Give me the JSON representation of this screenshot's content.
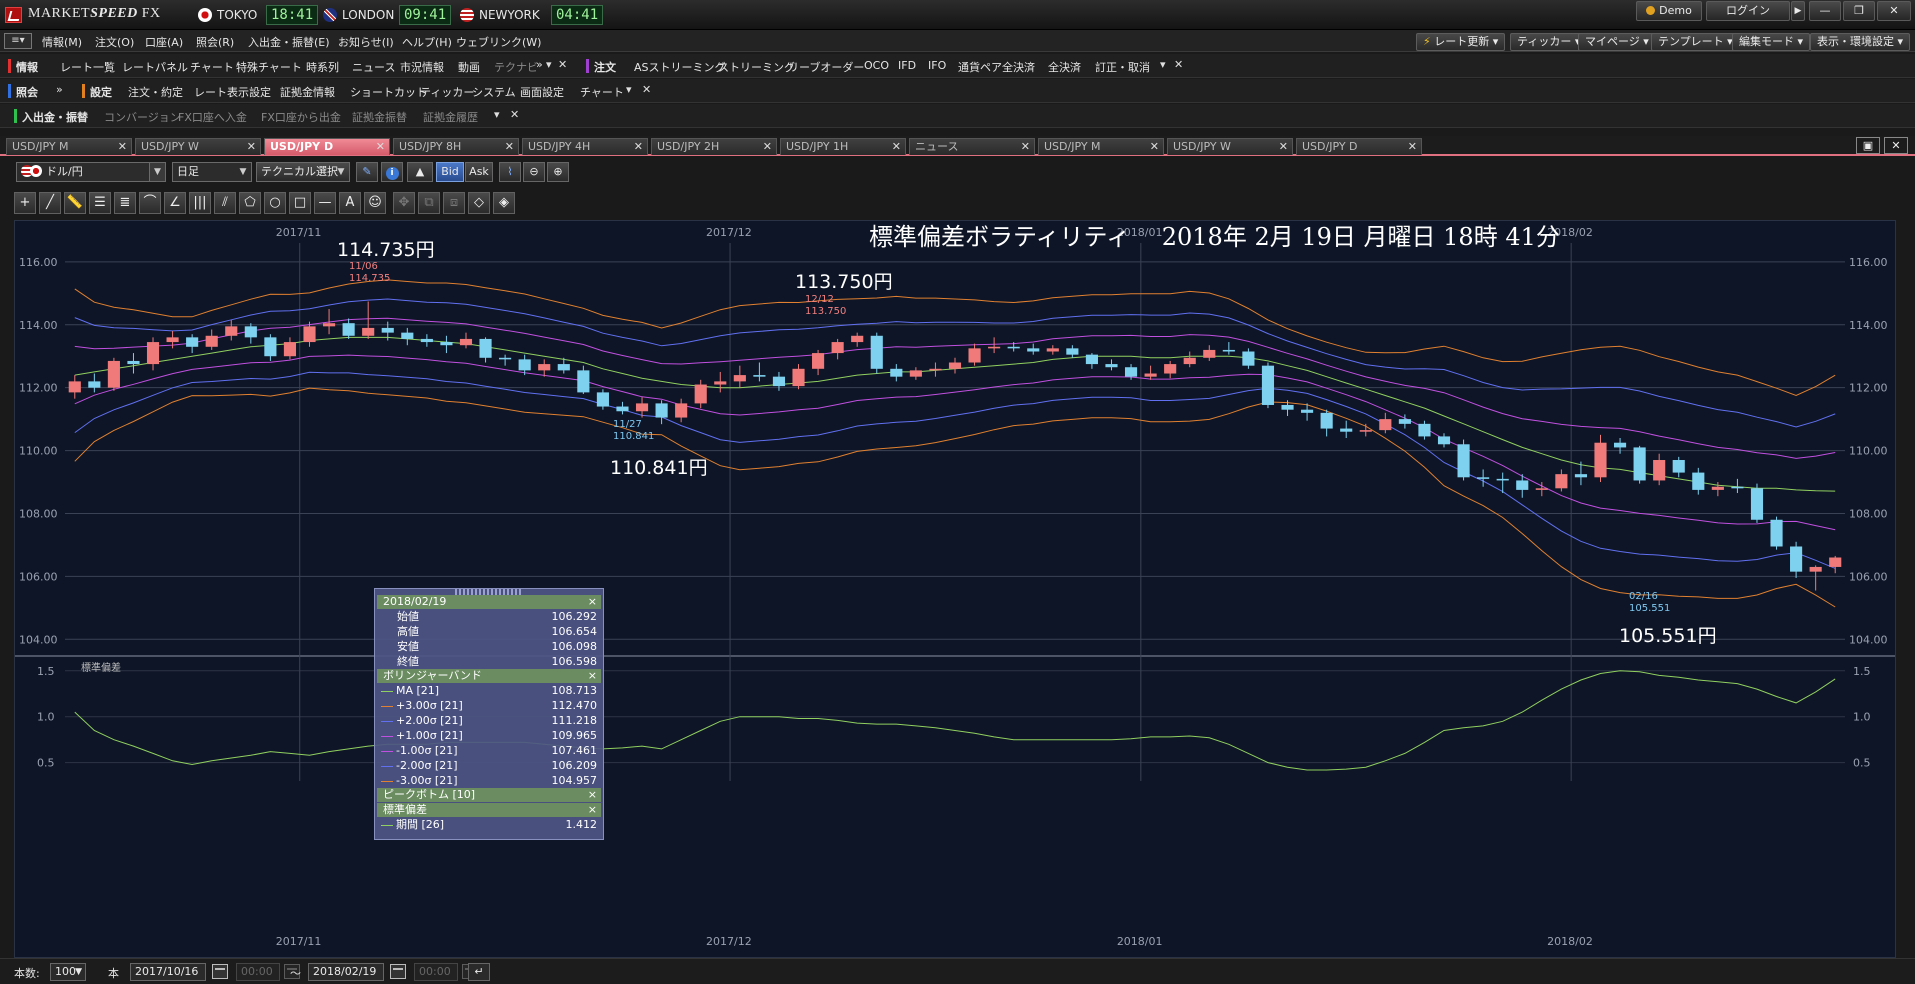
{
  "app": {
    "brand_a": "MARKET",
    "brand_b": "SPEED",
    "brand_c": " FX",
    "clocks": [
      {
        "city": "TOKYO",
        "time": "18:41"
      },
      {
        "city": "LONDON",
        "time": "09:41"
      },
      {
        "city": "NEWYORK",
        "time": "04:41"
      }
    ],
    "demo_label": "Demo",
    "login_label": "ログイン"
  },
  "menu": {
    "items": [
      "情報(M)",
      "注文(O)",
      "口座(A)",
      "照会(R)",
      "入出金・振替(E)",
      "お知らせ(I)",
      "ヘルプ(H)",
      "ウェブリンク(W)"
    ],
    "right_buttons": [
      "レート更新",
      "ティッカー",
      "マイページ",
      "テンプレート",
      "編集モード",
      "表示・環境設定"
    ]
  },
  "toolbar1": {
    "group1_title": "情報",
    "group1_items": [
      "レート一覧",
      "レートパネル",
      "チャート",
      "特殊チャート",
      "時系列",
      "ニュース",
      "市況情報",
      "動画",
      "テクナビ"
    ],
    "group2_title": "注文",
    "group2_items": [
      "ASストリーミング",
      "ストリーミング",
      "リーブオーダー",
      "OCO",
      "IFD",
      "IFO",
      "通貨ペア全決済",
      "全決済",
      "訂正・取消"
    ]
  },
  "toolbar2": {
    "group1_title": "照会",
    "group2_title": "設定",
    "group2_items": [
      "注文・約定",
      "レート表示設定",
      "証拠金情報",
      "ショートカット",
      "ティッカー",
      "システム",
      "画面設定",
      "チャート"
    ]
  },
  "toolbar3": {
    "group1_title": "入出金・振替",
    "group1_items": [
      "コンバージョン",
      "FX口座へ入金",
      "FX口座から出金",
      "証拠金振替",
      "証拠金履歴"
    ]
  },
  "tabs": [
    "USD/JPY M",
    "USD/JPY W",
    "USD/JPY D",
    "USD/JPY 8H",
    "USD/JPY 4H",
    "USD/JPY 2H",
    "USD/JPY 1H",
    "ニュース",
    "USD/JPY M",
    "USD/JPY W",
    "USD/JPY D"
  ],
  "active_tab": 2,
  "controls": {
    "pair": "ドル/円",
    "period": "日足",
    "technical": "テクニカル選択",
    "bid": "Bid",
    "ask": "Ask"
  },
  "chart_overlay_title": "標準偏差ボラティリティ　 2018年 2月 19日 月曜日 18時 41分",
  "annotations": {
    "high1": "114.735円",
    "high1_tag_date": "11/06",
    "high1_tag_val": "114.735",
    "high2": "113.750円",
    "high2_tag_date": "12/12",
    "high2_tag_val": "113.750",
    "low1": "110.841円",
    "low1_tag_date": "11/27",
    "low1_tag_val": "110.841",
    "low2": "105.551円",
    "low2_tag_date": "02/16",
    "low2_tag_val": "105.551"
  },
  "tooltip": {
    "date": "2018/02/19",
    "ohlc": [
      {
        "label": "始値",
        "value": "106.292"
      },
      {
        "label": "高値",
        "value": "106.654"
      },
      {
        "label": "安値",
        "value": "106.098"
      },
      {
        "label": "終値",
        "value": "106.598"
      }
    ],
    "bb_title": "ボリンジャーバンド",
    "bb": [
      {
        "label": "MA [21]",
        "value": "108.713",
        "color": "#90d060"
      },
      {
        "label": "+3.00σ [21]",
        "value": "112.470",
        "color": "#e08030"
      },
      {
        "label": "+2.00σ [21]",
        "value": "111.218",
        "color": "#6070f0"
      },
      {
        "label": "+1.00σ [21]",
        "value": "109.965",
        "color": "#c050e0"
      },
      {
        "label": "-1.00σ [21]",
        "value": "107.461",
        "color": "#c050e0"
      },
      {
        "label": "-2.00σ [21]",
        "value": "106.209",
        "color": "#6070f0"
      },
      {
        "label": "-3.00σ [21]",
        "value": "104.957",
        "color": "#e08030"
      }
    ],
    "peak_title": "ピークボトム [10]",
    "sd_title": "標準偏差",
    "sd": [
      {
        "label": "期間 [26]",
        "value": "1.412",
        "color": "#90d060"
      }
    ]
  },
  "status": {
    "count_label": "本数:",
    "count": "100",
    "unit": "本",
    "from": "2017/10/16",
    "from_time": "00:00",
    "tilde": "〜",
    "to": "2018/02/19",
    "to_time": "00:00"
  },
  "chart_data": {
    "type": "candlestick",
    "x": [
      "2017/10/16",
      "2017/10/17",
      "2017/10/18",
      "2017/10/19",
      "2017/10/20",
      "2017/10/23",
      "2017/10/24",
      "2017/10/25",
      "2017/10/26",
      "2017/10/27",
      "2017/10/30",
      "2017/10/31",
      "2017/11/01",
      "2017/11/02",
      "2017/11/03",
      "2017/11/06",
      "2017/11/07",
      "2017/11/08",
      "2017/11/09",
      "2017/11/10",
      "2017/11/13",
      "2017/11/14",
      "2017/11/15",
      "2017/11/16",
      "2017/11/17",
      "2017/11/20",
      "2017/11/21",
      "2017/11/22",
      "2017/11/23",
      "2017/11/24",
      "2017/11/27",
      "2017/11/28",
      "2017/11/29",
      "2017/11/30",
      "2017/12/01",
      "2017/12/04",
      "2017/12/05",
      "2017/12/06",
      "2017/12/07",
      "2017/12/08",
      "2017/12/11",
      "2017/12/12",
      "2017/12/13",
      "2017/12/14",
      "2017/12/15",
      "2017/12/18",
      "2017/12/19",
      "2017/12/20",
      "2017/12/21",
      "2017/12/22",
      "2017/12/25",
      "2017/12/26",
      "2017/12/27",
      "2017/12/28",
      "2017/12/29",
      "2018/01/01",
      "2018/01/02",
      "2018/01/03",
      "2018/01/04",
      "2018/01/05",
      "2018/01/08",
      "2018/01/09",
      "2018/01/10",
      "2018/01/11",
      "2018/01/12",
      "2018/01/15",
      "2018/01/16",
      "2018/01/17",
      "2018/01/18",
      "2018/01/19",
      "2018/01/22",
      "2018/01/23",
      "2018/01/24",
      "2018/01/25",
      "2018/01/26",
      "2018/01/29",
      "2018/01/30",
      "2018/01/31",
      "2018/02/01",
      "2018/02/02",
      "2018/02/05",
      "2018/02/06",
      "2018/02/07",
      "2018/02/08",
      "2018/02/09",
      "2018/02/12",
      "2018/02/13",
      "2018/02/14",
      "2018/02/15",
      "2018/02/16",
      "2018/02/19"
    ],
    "open": [
      111.85,
      112.2,
      112.0,
      112.85,
      112.75,
      113.45,
      113.6,
      113.3,
      113.65,
      113.95,
      113.6,
      113.0,
      113.45,
      113.95,
      114.05,
      113.65,
      113.9,
      113.75,
      113.55,
      113.45,
      113.35,
      113.55,
      112.95,
      112.9,
      112.55,
      112.75,
      112.55,
      111.85,
      111.4,
      111.25,
      111.5,
      111.05,
      111.5,
      112.1,
      112.2,
      112.4,
      112.35,
      112.05,
      112.6,
      113.1,
      113.45,
      113.65,
      112.6,
      112.35,
      112.55,
      112.6,
      112.8,
      113.25,
      113.3,
      113.25,
      113.15,
      113.25,
      113.05,
      112.75,
      112.65,
      112.35,
      112.45,
      112.75,
      112.95,
      113.2,
      113.15,
      112.7,
      111.45,
      111.3,
      111.2,
      110.7,
      110.6,
      110.65,
      111.0,
      110.85,
      110.45,
      110.2,
      109.15,
      109.1,
      109.05,
      108.75,
      108.8,
      109.25,
      109.15,
      110.25,
      110.1,
      109.05,
      109.7,
      109.3,
      108.75,
      108.85,
      108.8,
      107.8,
      106.95,
      106.15,
      106.3
    ],
    "close": [
      112.2,
      112.0,
      112.85,
      112.75,
      113.45,
      113.6,
      113.3,
      113.65,
      113.95,
      113.6,
      113.0,
      113.45,
      113.95,
      114.05,
      113.65,
      113.9,
      113.75,
      113.55,
      113.45,
      113.35,
      113.55,
      112.95,
      112.9,
      112.55,
      112.75,
      112.55,
      111.85,
      111.4,
      111.25,
      111.5,
      111.05,
      111.5,
      112.1,
      112.2,
      112.4,
      112.35,
      112.05,
      112.6,
      113.1,
      113.45,
      113.65,
      112.6,
      112.35,
      112.55,
      112.6,
      112.8,
      113.25,
      113.3,
      113.25,
      113.15,
      113.25,
      113.05,
      112.75,
      112.65,
      112.35,
      112.45,
      112.75,
      112.95,
      113.2,
      113.15,
      112.7,
      111.45,
      111.3,
      111.2,
      110.7,
      110.6,
      110.65,
      111.0,
      110.85,
      110.45,
      110.2,
      109.15,
      109.1,
      109.05,
      108.75,
      108.8,
      109.25,
      109.15,
      110.25,
      110.1,
      109.05,
      109.7,
      109.3,
      108.75,
      108.85,
      108.8,
      107.8,
      106.95,
      106.15,
      106.3,
      106.6
    ],
    "high": [
      112.4,
      112.45,
      112.95,
      113.1,
      113.6,
      113.8,
      113.7,
      113.85,
      114.15,
      114.05,
      113.7,
      113.6,
      114.1,
      114.5,
      114.2,
      114.74,
      114.1,
      113.9,
      113.7,
      113.65,
      113.75,
      113.6,
      113.05,
      113.05,
      112.9,
      112.95,
      112.7,
      111.95,
      111.55,
      111.7,
      111.6,
      111.65,
      112.25,
      112.5,
      112.7,
      112.8,
      112.5,
      112.75,
      113.2,
      113.55,
      113.75,
      113.75,
      112.75,
      112.65,
      112.8,
      112.95,
      113.4,
      113.6,
      113.45,
      113.4,
      113.35,
      113.35,
      113.1,
      112.9,
      112.75,
      112.7,
      112.85,
      113.15,
      113.35,
      113.45,
      113.25,
      112.8,
      111.6,
      111.5,
      111.3,
      110.95,
      110.85,
      111.2,
      111.15,
      110.95,
      110.55,
      110.35,
      109.4,
      109.3,
      109.25,
      109.0,
      109.4,
      109.65,
      110.5,
      110.4,
      110.15,
      109.9,
      109.8,
      109.45,
      109.0,
      109.1,
      108.95,
      107.9,
      107.1,
      106.35,
      106.65
    ],
    "low": [
      111.65,
      111.85,
      111.9,
      112.45,
      112.55,
      113.25,
      113.1,
      113.2,
      113.5,
      113.4,
      112.85,
      112.9,
      113.3,
      113.7,
      113.55,
      113.55,
      113.5,
      113.35,
      113.3,
      113.1,
      113.25,
      112.8,
      112.7,
      112.4,
      112.35,
      112.45,
      111.8,
      111.3,
      111.15,
      111.05,
      110.84,
      110.9,
      111.35,
      111.85,
      112.0,
      112.2,
      111.9,
      111.95,
      112.4,
      112.9,
      113.3,
      112.45,
      112.2,
      112.25,
      112.35,
      112.45,
      112.7,
      113.1,
      113.15,
      113.05,
      113.05,
      112.95,
      112.6,
      112.55,
      112.25,
      112.25,
      112.3,
      112.65,
      112.85,
      113.05,
      112.6,
      111.35,
      111.1,
      110.95,
      110.45,
      110.4,
      110.45,
      110.55,
      110.7,
      110.35,
      110.1,
      109.05,
      108.85,
      108.65,
      108.5,
      108.55,
      108.7,
      108.9,
      109.0,
      109.9,
      108.95,
      108.9,
      109.15,
      108.6,
      108.55,
      108.65,
      107.7,
      106.85,
      105.95,
      105.55,
      106.1
    ],
    "bb": {
      "ma": [
        112.4,
        112.5,
        112.6,
        112.7,
        112.8,
        112.9,
        113.0,
        113.1,
        113.2,
        113.3,
        113.35,
        113.4,
        113.5,
        113.55,
        113.6,
        113.6,
        113.6,
        113.55,
        113.5,
        113.45,
        113.4,
        113.3,
        113.2,
        113.1,
        113.0,
        112.9,
        112.8,
        112.6,
        112.45,
        112.3,
        112.2,
        112.1,
        112.05,
        112.0,
        112.0,
        112.05,
        112.1,
        112.15,
        112.2,
        112.3,
        112.4,
        112.45,
        112.5,
        112.5,
        112.55,
        112.6,
        112.65,
        112.7,
        112.75,
        112.8,
        112.9,
        112.95,
        113.0,
        113.0,
        113.0,
        112.95,
        112.95,
        113.0,
        113.0,
        113.0,
        112.95,
        112.85,
        112.7,
        112.55,
        112.35,
        112.15,
        111.95,
        111.75,
        111.55,
        111.35,
        111.1,
        110.85,
        110.6,
        110.35,
        110.1,
        109.9,
        109.7,
        109.55,
        109.45,
        109.4,
        109.3,
        109.2,
        109.1,
        109.0,
        108.9,
        108.85,
        108.8,
        108.8,
        108.75,
        108.72,
        108.71
      ]
    },
    "sd": [
      1.05,
      0.85,
      0.75,
      0.68,
      0.6,
      0.52,
      0.48,
      0.52,
      0.55,
      0.58,
      0.62,
      0.6,
      0.58,
      0.62,
      0.65,
      0.68,
      0.7,
      0.7,
      0.7,
      0.72,
      0.72,
      0.72,
      0.72,
      0.72,
      0.7,
      0.68,
      0.66,
      0.65,
      0.66,
      0.68,
      0.65,
      0.75,
      0.85,
      0.95,
      1.0,
      1.0,
      1.0,
      0.98,
      0.98,
      0.96,
      0.93,
      0.92,
      0.92,
      0.9,
      0.88,
      0.85,
      0.82,
      0.78,
      0.75,
      0.75,
      0.75,
      0.75,
      0.75,
      0.75,
      0.76,
      0.78,
      0.78,
      0.79,
      0.77,
      0.7,
      0.6,
      0.5,
      0.45,
      0.42,
      0.42,
      0.43,
      0.45,
      0.52,
      0.6,
      0.72,
      0.85,
      0.88,
      0.9,
      0.95,
      1.05,
      1.18,
      1.3,
      1.4,
      1.47,
      1.5,
      1.49,
      1.45,
      1.43,
      1.4,
      1.38,
      1.36,
      1.3,
      1.22,
      1.15,
      1.27,
      1.412
    ],
    "ylim": [
      103.5,
      116.6
    ],
    "sd_ylim": [
      0.3,
      1.65
    ],
    "y_ticks": [
      "116.00",
      "114.00",
      "112.00",
      "110.00",
      "108.00",
      "106.00",
      "104.00"
    ],
    "sd_ticks": [
      "1.5",
      "1.0",
      "0.5"
    ],
    "month_labels": [
      {
        "label": "2017/11",
        "index": 12
      },
      {
        "label": "2017/12",
        "index": 34
      },
      {
        "label": "2018/01",
        "index": 55
      },
      {
        "label": "2018/02",
        "index": 77
      }
    ],
    "sub_title": "標準偏差",
    "up_color": "#f07a7a",
    "down_color": "#7ed2f0"
  }
}
